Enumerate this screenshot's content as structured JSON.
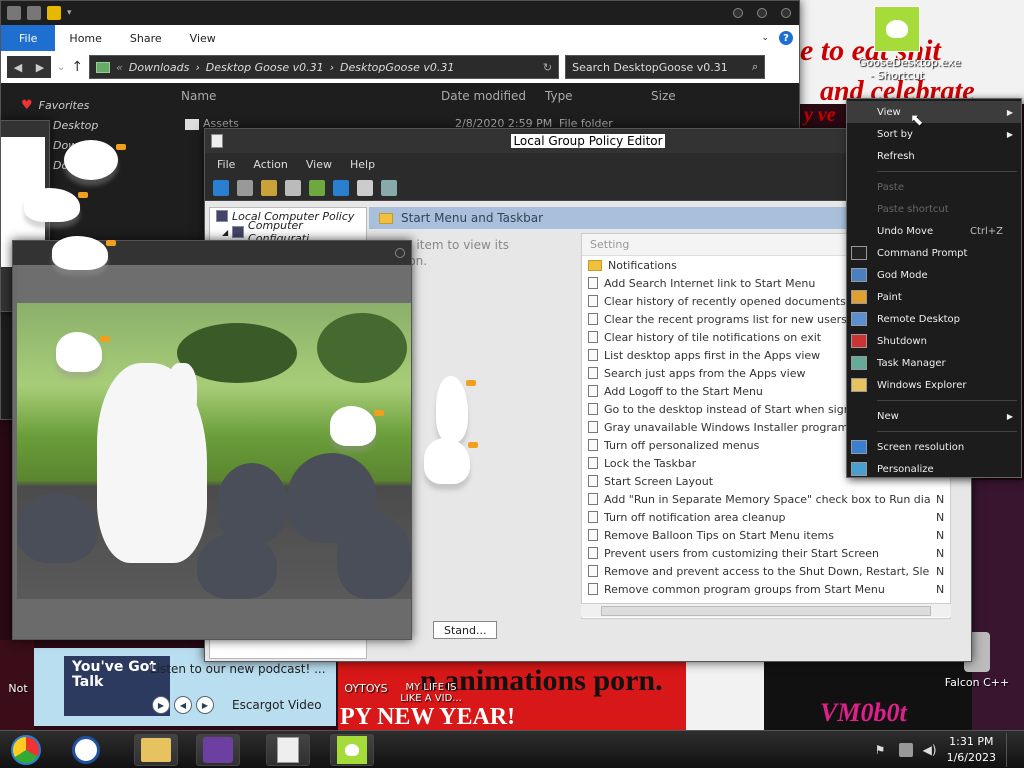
{
  "explorer": {
    "tabs": [
      "File",
      "Home",
      "Share",
      "View"
    ],
    "address": [
      "Downloads",
      "Desktop Goose v0.31",
      "DesktopGoose v0.31"
    ],
    "search_placeholder": "Search DesktopGoose v0.31",
    "columns": [
      "Name",
      "Date modified",
      "Type",
      "Size"
    ],
    "favorites_label": "Favorites",
    "nav_items": [
      "Desktop",
      "Dow",
      "Dow"
    ],
    "first_file": {
      "name": "Assets",
      "date": "2/8/2020 2:59 PM",
      "type": "File folder"
    }
  },
  "gpedit": {
    "title": "Local Group Policy Editor",
    "menu": [
      "File",
      "Action",
      "View",
      "Help"
    ],
    "tree": [
      "Local Computer Policy",
      "Computer Configurati"
    ],
    "section_title": "Start Menu and Taskbar",
    "description": "n item to view its\nion.",
    "list_header": "Setting",
    "settings": [
      {
        "label": "Notifications",
        "state": ""
      },
      {
        "label": "Add Search Internet link to Start Menu",
        "state": ""
      },
      {
        "label": "Clear history of recently opened documents o",
        "state": ""
      },
      {
        "label": "Clear the recent programs list for new users",
        "state": ""
      },
      {
        "label": "Clear history of tile notifications on exit",
        "state": ""
      },
      {
        "label": "List desktop apps first in the Apps view",
        "state": ""
      },
      {
        "label": "Search just apps from the Apps view",
        "state": ""
      },
      {
        "label": "Add Logoff to the Start Menu",
        "state": ""
      },
      {
        "label": "Go to the desktop instead of Start when sign",
        "state": ""
      },
      {
        "label": "Gray unavailable Windows Installer program",
        "state": ""
      },
      {
        "label": "Turn off personalized menus",
        "state": ""
      },
      {
        "label": "Lock the Taskbar",
        "state": ""
      },
      {
        "label": "Start Screen Layout",
        "state": ""
      },
      {
        "label": "Add \"Run in Separate Memory Space\" check box to Run dia...",
        "state": "N"
      },
      {
        "label": "Turn off notification area cleanup",
        "state": "N"
      },
      {
        "label": "Remove Balloon Tips on Start Menu items",
        "state": "N"
      },
      {
        "label": "Prevent users from customizing their Start Screen",
        "state": "N"
      },
      {
        "label": "Remove and prevent access to the Shut Down, Restart, Sle...",
        "state": "N"
      },
      {
        "label": "Remove common program groups from Start Menu",
        "state": "N"
      }
    ],
    "tab_label": "Stand..."
  },
  "context_menu": {
    "items": [
      {
        "label": "View",
        "type": "submenu",
        "selected": true
      },
      {
        "label": "Sort by",
        "type": "submenu"
      },
      {
        "label": "Refresh",
        "type": "item"
      },
      {
        "type": "sep"
      },
      {
        "label": "Paste",
        "type": "disabled"
      },
      {
        "label": "Paste shortcut",
        "type": "disabled"
      },
      {
        "label": "Undo Move",
        "type": "item",
        "shortcut": "Ctrl+Z"
      },
      {
        "label": "Command Prompt",
        "type": "item",
        "icon": "cmd-icon"
      },
      {
        "label": "God Mode",
        "type": "item",
        "icon": "control-panel-icon"
      },
      {
        "label": "Paint",
        "type": "item",
        "icon": "paint-icon"
      },
      {
        "label": "Remote Desktop",
        "type": "item",
        "icon": "remote-desktop-icon"
      },
      {
        "label": "Shutdown",
        "type": "item",
        "icon": "shield-icon"
      },
      {
        "label": "Task Manager",
        "type": "item",
        "icon": "task-manager-icon"
      },
      {
        "label": "Windows Explorer",
        "type": "item",
        "icon": "folder-icon"
      },
      {
        "type": "sep"
      },
      {
        "label": "New",
        "type": "submenu"
      },
      {
        "type": "sep"
      },
      {
        "label": "Screen resolution",
        "type": "item",
        "icon": "monitor-icon"
      },
      {
        "label": "Personalize",
        "type": "item",
        "icon": "personalize-icon"
      }
    ]
  },
  "desktop": {
    "goose_shortcut_label": "GooseDesktop.exe - Shortcut",
    "falcon_label": "Falcon C++",
    "not_label": "Not",
    "podcast_text": "Listen to our new podcast! ...",
    "podcast_thumb": "You've Got Talk",
    "escargot_label": "Escargot Video",
    "toys_label": "OYTOYS",
    "my_life_label": "MY LIFE IS LIKE A VID...",
    "meme_top": "e to eat shit",
    "meme_top2": "and celebrate",
    "meme_top3": "y ve",
    "meme_bottom": "n animations porn.",
    "meme_bottom2": "PY NEW YEAR!",
    "vmob_label": "VM0b0t"
  },
  "taskbar": {
    "time": "1:31 PM",
    "date": "1/6/2023"
  },
  "colors": {
    "accent_blue": "#1e6fcf",
    "goose_green": "#a6dc3a",
    "meme_red": "#cc0000"
  }
}
